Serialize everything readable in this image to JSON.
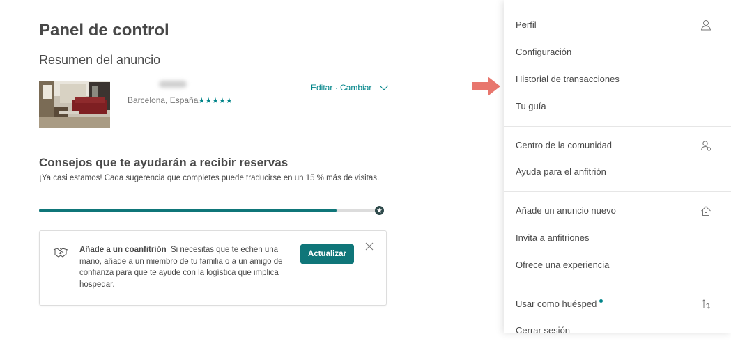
{
  "dashboard": {
    "title": "Panel de control",
    "summary_title": "Resumen del anuncio",
    "listing": {
      "location": "Barcelona, España",
      "stars": "★★★★★",
      "edit_link": "Editar · Cambiar"
    },
    "tips": {
      "title": "Consejos que te ayudarán a recibir reservas",
      "description": "¡Ya casi estamos! Cada sugerencia que completes puede traducirse en un 15 % más de visitas.",
      "progress_fraction": 0.88
    },
    "cohost_card": {
      "title": "Añade a un coanfitrión",
      "body": "Si necesitas que te echen una mano, añade a un miembro de tu familia o a un amigo de confianza para que te ayude con la logística que implica hospedar.",
      "button_label": "Actualizar"
    }
  },
  "menu": {
    "items": [
      {
        "label": "Perfil",
        "icon": "user-icon"
      },
      {
        "label": "Configuración"
      },
      {
        "label": "Historial de transacciones"
      },
      {
        "label": "Tu guía"
      },
      {
        "label": "Centro de la comunidad",
        "icon": "community-icon"
      },
      {
        "label": "Ayuda para el anfitrión"
      },
      {
        "label": "Añade un anuncio nuevo",
        "icon": "home-icon"
      },
      {
        "label": "Invita a anfitriones"
      },
      {
        "label": "Ofrece una experiencia"
      },
      {
        "label": "Usar como huésped",
        "icon": "switch-icon"
      },
      {
        "label": "Cerrar sesión"
      }
    ]
  },
  "colors": {
    "accent": "#008489",
    "button": "#0f7679",
    "arrow": "#e8766d",
    "text": "#484848"
  }
}
